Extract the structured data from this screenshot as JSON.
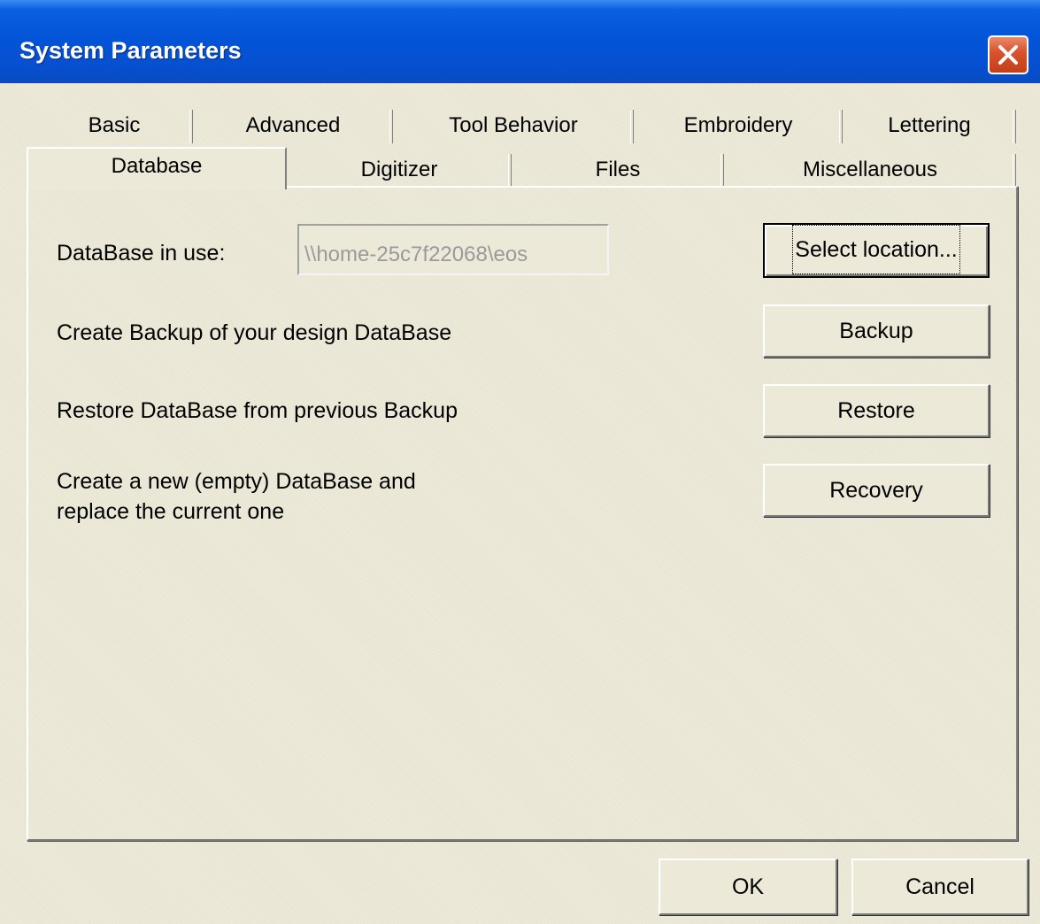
{
  "window": {
    "title": "System Parameters"
  },
  "tabs": {
    "row_back": [
      {
        "label": "Basic"
      },
      {
        "label": "Advanced"
      },
      {
        "label": "Tool Behavior"
      },
      {
        "label": "Embroidery"
      },
      {
        "label": "Lettering"
      }
    ],
    "row_front": [
      {
        "label": "Database",
        "selected": true
      },
      {
        "label": "Digitizer"
      },
      {
        "label": "Files"
      },
      {
        "label": "Miscellaneous"
      }
    ]
  },
  "database": {
    "in_use_label": "DataBase in use:",
    "path_value": "\\\\home-25c7f22068\\eos",
    "select_location_button": "Select location...",
    "backup_text": "Create Backup of your design DataBase",
    "backup_button": "Backup",
    "restore_text": "Restore DataBase from previous Backup",
    "restore_button": "Restore",
    "recovery_text_line1": "Create a new (empty) DataBase and",
    "recovery_text_line2": "replace the current one",
    "recovery_button": "Recovery"
  },
  "footer": {
    "ok_button": "OK",
    "cancel_button": "Cancel"
  },
  "icons": {
    "close": "close-icon"
  },
  "colors": {
    "titlebar": "#0454d8",
    "close_button": "#d9542c",
    "dialog_face": "#ece9d8"
  }
}
